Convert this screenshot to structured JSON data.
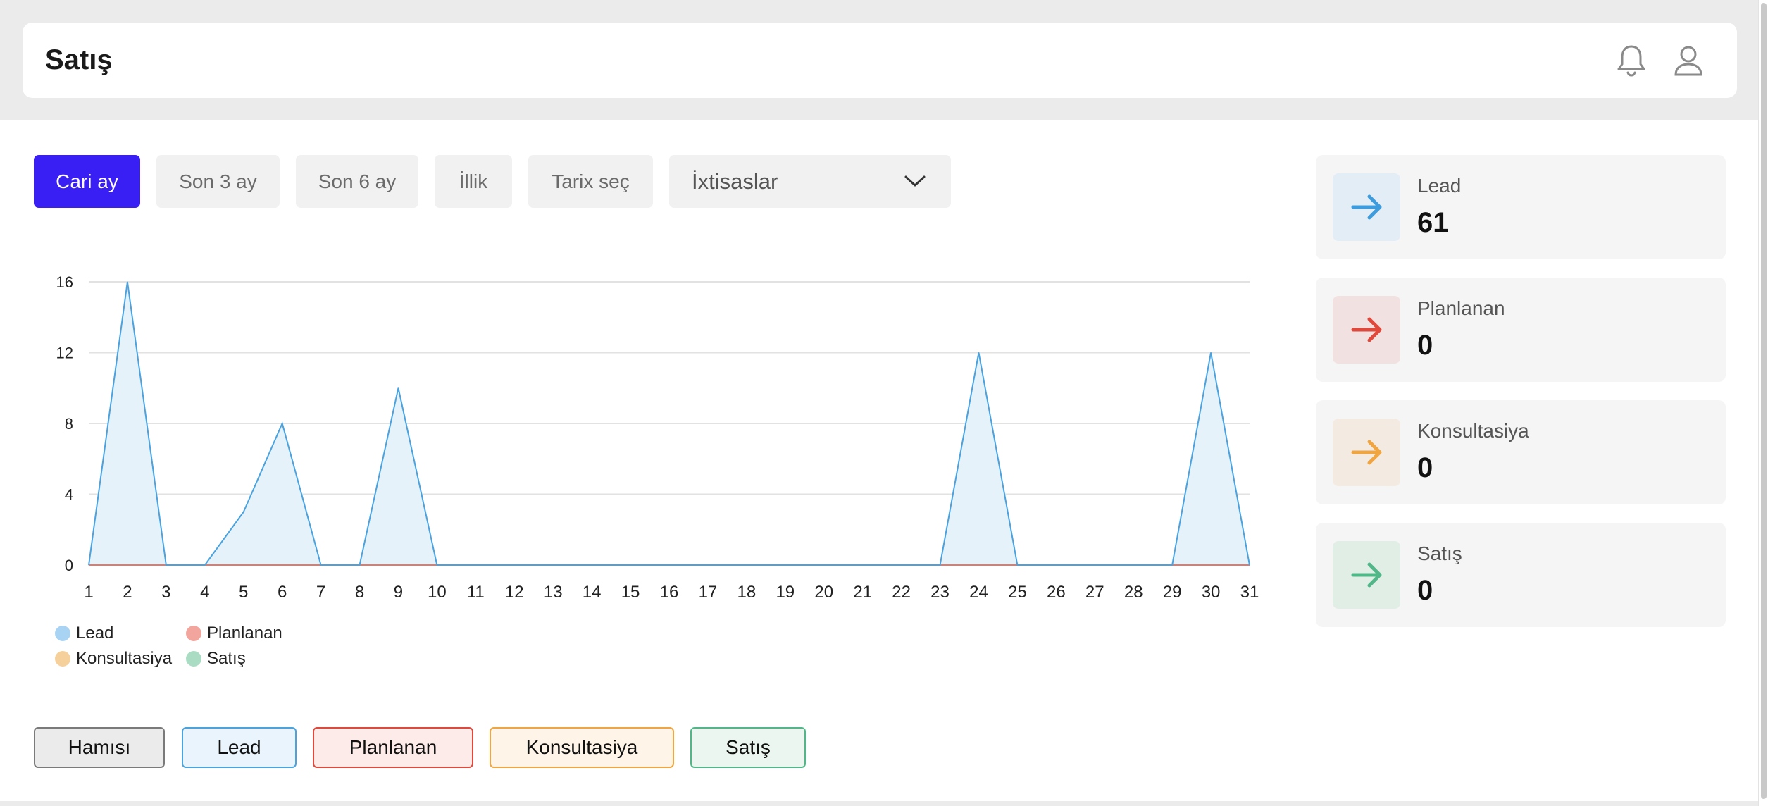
{
  "header": {
    "title": "Satış",
    "icons": [
      "bell-icon",
      "user-icon"
    ]
  },
  "filters": {
    "buttons": [
      {
        "label": "Cari ay",
        "active": true
      },
      {
        "label": "Son 3 ay",
        "active": false
      },
      {
        "label": "Son 6 ay",
        "active": false
      },
      {
        "label": "İllik",
        "active": false
      },
      {
        "label": "Tarix seç",
        "active": false
      }
    ],
    "specialties_select": {
      "value": "İxtisaslar",
      "icon": "chevron-down-icon"
    }
  },
  "chart_data": {
    "type": "area",
    "title": "",
    "xlabel": "",
    "ylabel": "",
    "x": [
      1,
      2,
      3,
      4,
      5,
      6,
      7,
      8,
      9,
      10,
      11,
      12,
      13,
      14,
      15,
      16,
      17,
      18,
      19,
      20,
      21,
      22,
      23,
      24,
      25,
      26,
      27,
      28,
      29,
      30,
      31
    ],
    "ylim": [
      0,
      16
    ],
    "yticks": [
      0,
      4,
      8,
      12,
      16
    ],
    "grid": true,
    "legend_position": "bottom-left",
    "series": [
      {
        "name": "Lead",
        "color": "#4aa3df",
        "fill": "#e6f2fa",
        "values": [
          0,
          16,
          0,
          0,
          3,
          8,
          0,
          0,
          10,
          0,
          0,
          0,
          0,
          0,
          0,
          0,
          0,
          0,
          0,
          0,
          0,
          0,
          0,
          12,
          0,
          0,
          0,
          0,
          0,
          12,
          0
        ]
      },
      {
        "name": "Planlanan",
        "color": "#e8776a",
        "fill": "#fbe4e1",
        "values": [
          0,
          0,
          0,
          0,
          0,
          0,
          0,
          0,
          0,
          0,
          0,
          0,
          0,
          0,
          0,
          0,
          0,
          0,
          0,
          0,
          0,
          0,
          0,
          0,
          0,
          0,
          0,
          0,
          0,
          0,
          0
        ]
      },
      {
        "name": "Konsultasiya",
        "color": "#f0b565",
        "fill": "#fdf0de",
        "values": [
          0,
          0,
          0,
          0,
          0,
          0,
          0,
          0,
          0,
          0,
          0,
          0,
          0,
          0,
          0,
          0,
          0,
          0,
          0,
          0,
          0,
          0,
          0,
          0,
          0,
          0,
          0,
          0,
          0,
          0,
          0
        ]
      },
      {
        "name": "Satış",
        "color": "#52b788",
        "fill": "#e3f3ea",
        "values": [
          0,
          0,
          0,
          0,
          0,
          0,
          0,
          0,
          0,
          0,
          0,
          0,
          0,
          0,
          0,
          0,
          0,
          0,
          0,
          0,
          0,
          0,
          0,
          0,
          0,
          0,
          0,
          0,
          0,
          0,
          0
        ]
      }
    ]
  },
  "legend": [
    {
      "label": "Lead",
      "color": "#a9d3f2"
    },
    {
      "label": "Planlanan",
      "color": "#f1a59c"
    },
    {
      "label": "Konsultasiya",
      "color": "#f6d09a"
    },
    {
      "label": "Satış",
      "color": "#a9dcc3"
    }
  ],
  "series_toggles": [
    {
      "label": "Hamısı",
      "bg": "#ebebeb",
      "border": "#7a7a7a"
    },
    {
      "label": "Lead",
      "bg": "#eaf4fc",
      "border": "#4aa3df"
    },
    {
      "label": "Planlanan",
      "bg": "#fcebe8",
      "border": "#e0483b"
    },
    {
      "label": "Konsultasiya",
      "bg": "#fef5e8",
      "border": "#f0a540"
    },
    {
      "label": "Satış",
      "bg": "#eaf6ef",
      "border": "#52b788"
    }
  ],
  "stats": [
    {
      "label": "Lead",
      "value": "61",
      "icon": "arrow-right-icon",
      "color": "#3e9bdc",
      "icon_bg": "#e3edf6"
    },
    {
      "label": "Planlanan",
      "value": "0",
      "icon": "arrow-right-icon",
      "color": "#e0483b",
      "icon_bg": "#f1e1e0"
    },
    {
      "label": "Konsultasiya",
      "value": "0",
      "icon": "arrow-right-icon",
      "color": "#f0a540",
      "icon_bg": "#f3ebe1"
    },
    {
      "label": "Satış",
      "value": "0",
      "icon": "arrow-right-icon",
      "color": "#52b788",
      "icon_bg": "#e1eee6"
    }
  ]
}
